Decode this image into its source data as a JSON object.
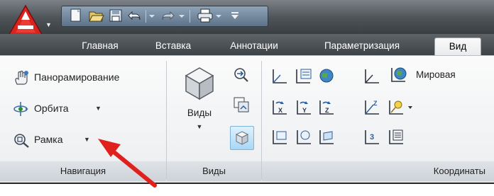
{
  "quick_access": {
    "icons": [
      "new-icon",
      "open-icon",
      "save-icon",
      "undo-icon",
      "redo-icon",
      "plot-icon",
      "customize-icon"
    ]
  },
  "tabs": [
    {
      "label": "Главная"
    },
    {
      "label": "Вставка"
    },
    {
      "label": "Аннотации"
    },
    {
      "label": "Параметризация"
    },
    {
      "label": "Вид",
      "active": true
    }
  ],
  "navigation": {
    "pan_label": "Панорамирование",
    "orbit_label": "Орбита",
    "zoom_label": "Рамка",
    "panel_title": "Навигация"
  },
  "views": {
    "views_label": "Виды",
    "panel_title": "Виды"
  },
  "coordinates": {
    "world_label": "Мировая",
    "panel_title": "Координаты"
  },
  "colors": {
    "accent_red": "#d9231f",
    "arrow_red": "#e0201c",
    "ucs_blue": "#2c5f9e"
  }
}
